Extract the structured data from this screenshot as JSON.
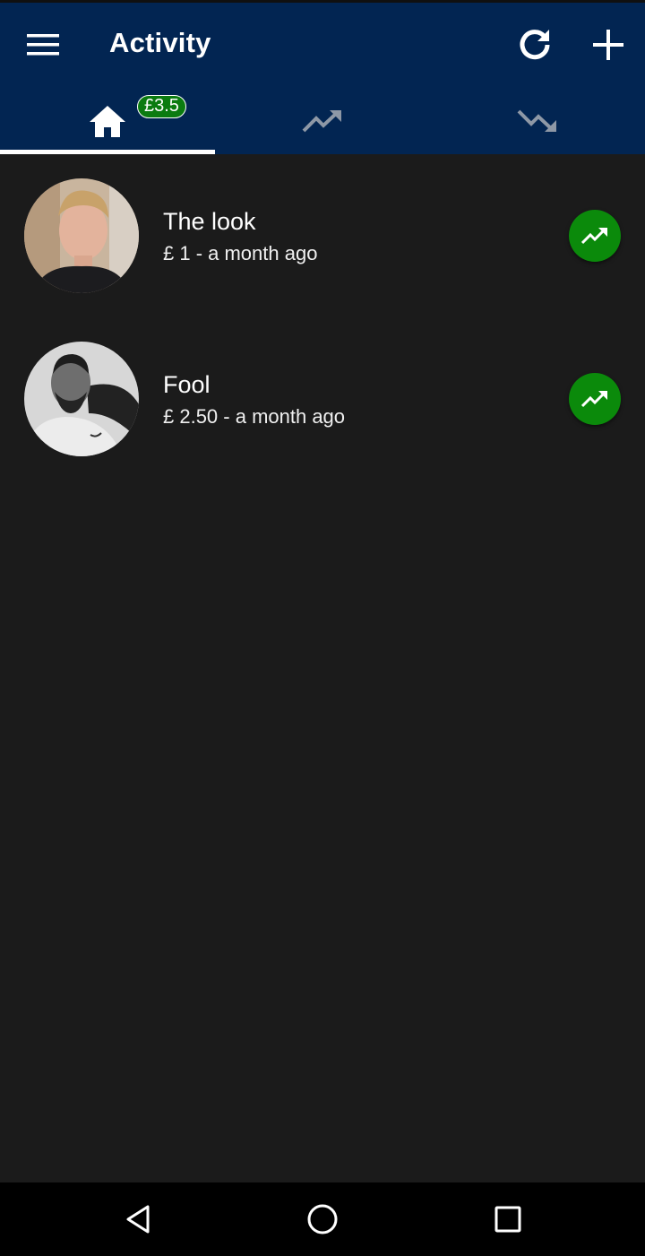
{
  "appbar": {
    "title": "Activity",
    "icons": {
      "menu": "menu-icon",
      "refresh": "refresh-icon",
      "add": "add-icon"
    }
  },
  "tabs": [
    {
      "icon": "home-icon",
      "badge": "£3.5",
      "selected": true
    },
    {
      "icon": "trending-up-icon",
      "selected": false
    },
    {
      "icon": "trending-down-icon",
      "selected": false
    }
  ],
  "activities": [
    {
      "name": "The look",
      "meta": "£ 1 - a month ago",
      "trend": "trending-up-icon"
    },
    {
      "name": "Fool",
      "meta": "£ 2.50 - a month ago",
      "trend": "trending-up-icon"
    }
  ],
  "colors": {
    "appbar": "#022552",
    "background": "#1b1b1b",
    "trend_button": "#0b8a0b",
    "badge": "#0b7b10"
  },
  "system_nav": {
    "icons": [
      "back-icon",
      "home-circle-icon",
      "recents-icon"
    ]
  }
}
